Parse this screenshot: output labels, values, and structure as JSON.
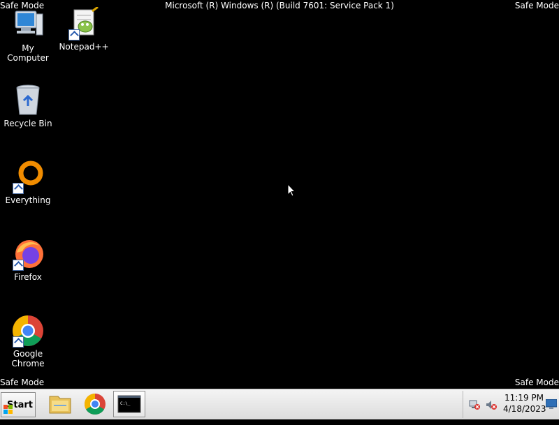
{
  "screen": {
    "safe_mode_label": "Safe Mode",
    "title": "Microsoft (R) Windows (R) (Build 7601: Service Pack 1)"
  },
  "desktop": {
    "icons": [
      {
        "label": "My Computer"
      },
      {
        "label": "Notepad++"
      },
      {
        "label": "Recycle Bin"
      },
      {
        "label": "Everything"
      },
      {
        "label": "Firefox"
      },
      {
        "label": "Google Chrome"
      }
    ]
  },
  "taskbar": {
    "start_label": "Start",
    "pinned": [
      "file-explorer-icon",
      "chrome-icon",
      "command-prompt-icon"
    ],
    "clock": {
      "time": "11:19 PM",
      "date": "4/18/2023"
    }
  },
  "colors": {
    "desktop_bg": "#000000",
    "taskbar_bg": "#e6e6e6"
  }
}
